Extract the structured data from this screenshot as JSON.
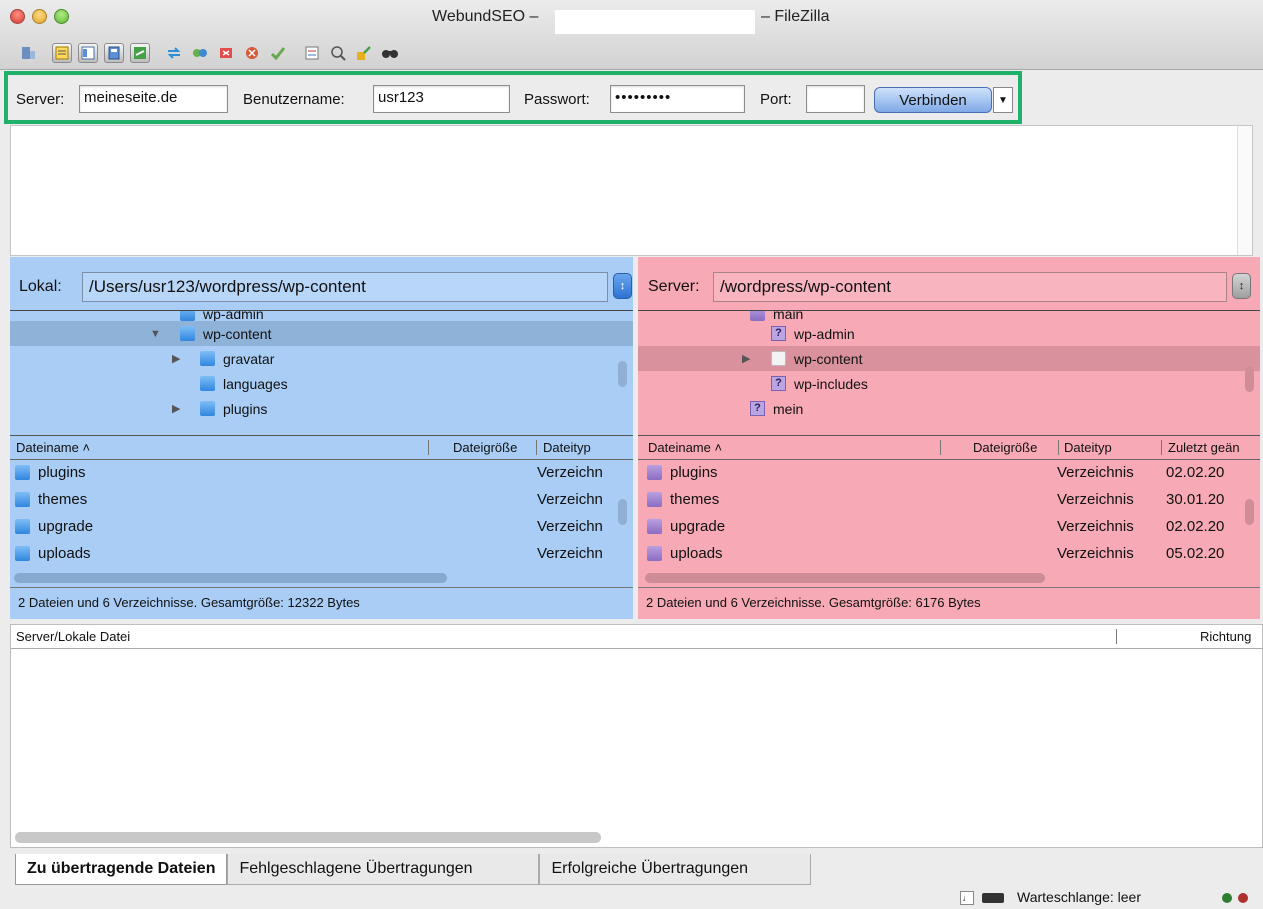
{
  "window": {
    "title_left": "WebundSEO –",
    "title_right": "– FileZilla"
  },
  "toolbar": {
    "icons": [
      "site-manager-icon",
      "message-log-icon",
      "directory-tree-icon",
      "remote-tree-icon",
      "transfer-queue-icon",
      "refresh-icon",
      "process-queue-icon",
      "cancel-icon",
      "disconnect-icon",
      "reconnect-icon",
      "filter-icon",
      "compare-icon",
      "sync-browse-icon",
      "search-icon"
    ]
  },
  "quickconnect": {
    "server_label": "Server:",
    "server_value": "meineseite.de",
    "user_label": "Benutzername:",
    "user_value": "usr123",
    "password_label": "Passwort:",
    "password_value": "•••••••••",
    "port_label": "Port:",
    "port_value": "",
    "connect_label": "Verbinden",
    "outline_color": "#1fb06a"
  },
  "local": {
    "path_label": "Lokal:",
    "path_value": "/Users/usr123/wordpress/wp-content",
    "tree_partial": "wp-admin",
    "tree": [
      {
        "label": "wp-content",
        "expanded": true
      },
      {
        "label": "gravatar"
      },
      {
        "label": "languages"
      },
      {
        "label": "plugins"
      }
    ],
    "columns": {
      "name": "Dateiname",
      "size": "Dateigröße",
      "type": "Dateityp"
    },
    "files": [
      {
        "name": "plugins",
        "type": "Verzeichn"
      },
      {
        "name": "themes",
        "type": "Verzeichn"
      },
      {
        "name": "upgrade",
        "type": "Verzeichn"
      },
      {
        "name": "uploads",
        "type": "Verzeichn"
      }
    ],
    "status": "2 Dateien und 6 Verzeichnisse. Gesamtgröße: 12322 Bytes",
    "bg_color": "#a9cdf5"
  },
  "remote": {
    "path_label": "Server:",
    "path_value": "/wordpress/wp-content",
    "tree_partial": "main",
    "tree": [
      {
        "label": "wp-admin"
      },
      {
        "label": "wp-content"
      },
      {
        "label": "wp-includes"
      },
      {
        "label": "mein"
      }
    ],
    "columns": {
      "name": "Dateiname",
      "size": "Dateigröße",
      "type": "Dateityp",
      "modified": "Zuletzt geän"
    },
    "files": [
      {
        "name": "plugins",
        "type": "Verzeichnis",
        "date": "02.02.20"
      },
      {
        "name": "themes",
        "type": "Verzeichnis",
        "date": "30.01.20"
      },
      {
        "name": "upgrade",
        "type": "Verzeichnis",
        "date": "02.02.20"
      },
      {
        "name": "uploads",
        "type": "Verzeichnis",
        "date": "05.02.20"
      }
    ],
    "status": "2 Dateien und 6 Verzeichnisse. Gesamtgröße: 6176 Bytes",
    "bg_color": "#f7aab5"
  },
  "queue": {
    "col_file": "Server/Lokale Datei",
    "col_direction": "Richtung"
  },
  "tabs": [
    {
      "label": "Zu übertragende Dateien",
      "active": true
    },
    {
      "label": "Fehlgeschlagene Übertragungen"
    },
    {
      "label": "Erfolgreiche Übertragungen"
    }
  ],
  "statusbar": {
    "queue_text": "Warteschlange: leer"
  }
}
